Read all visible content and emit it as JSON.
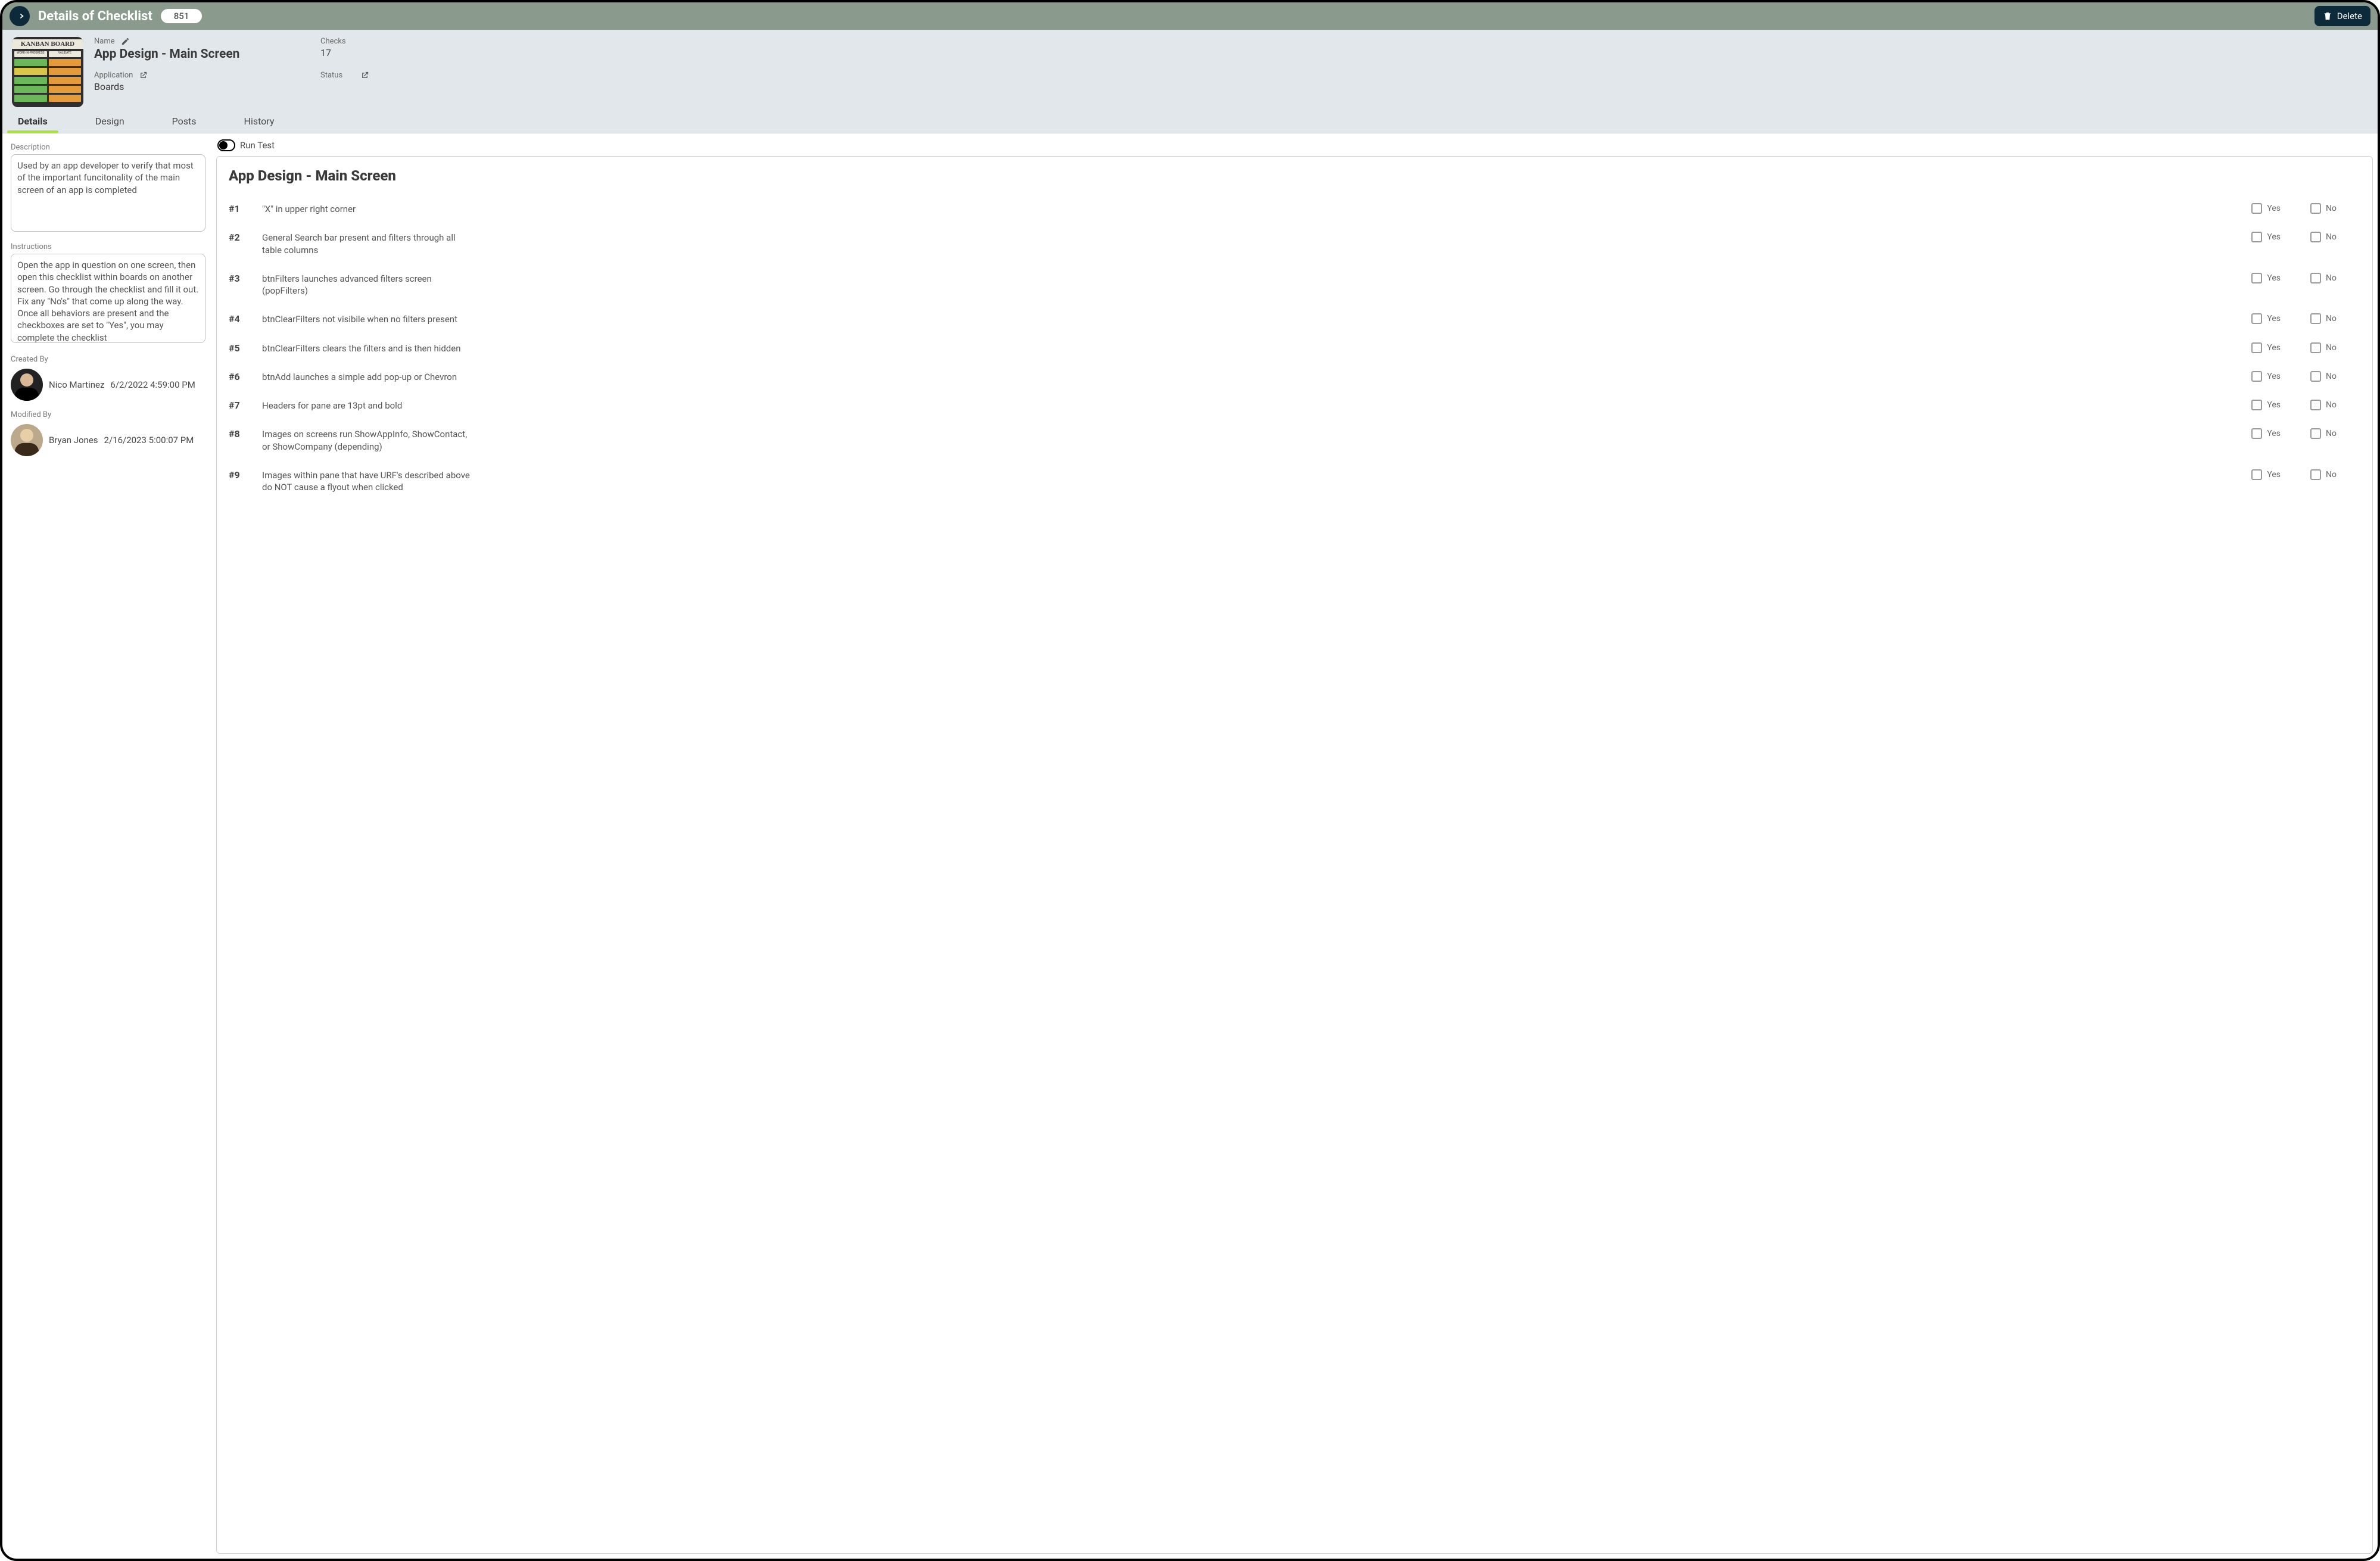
{
  "header": {
    "title": "Details of Checklist",
    "badge": "851",
    "delete_label": "Delete"
  },
  "thumbnail": {
    "title": "KANBAN BOARD",
    "col_labels": [
      "WORK-IN-PROGRESS",
      "VALIDATE"
    ]
  },
  "info": {
    "name_label": "Name",
    "name_value": "App Design - Main Screen",
    "application_label": "Application",
    "application_value": "Boards",
    "checks_label": "Checks",
    "checks_value": "17",
    "status_label": "Status",
    "status_value": ""
  },
  "tabs": [
    {
      "key": "details",
      "label": "Details",
      "active": true
    },
    {
      "key": "design",
      "label": "Design",
      "active": false
    },
    {
      "key": "posts",
      "label": "Posts",
      "active": false
    },
    {
      "key": "history",
      "label": "History",
      "active": false
    }
  ],
  "left": {
    "description_label": "Description",
    "description_value": "Used by an app developer to verify that most of the important funcitonality of the main screen of an app is completed",
    "instructions_label": "Instructions",
    "instructions_value": "Open the app in question on one screen, then open this checklist within boards on another screen. Go through the checklist and fill it out. Fix any \"No's\" that come up along the way. Once all behaviors are present and the checkboxes are set to \"Yes\", you may complete the checklist",
    "created_label": "Created By",
    "created_name": "Nico Martinez",
    "created_date": "6/2/2022 4:59:00 PM",
    "modified_label": "Modified By",
    "modified_name": "Bryan Jones",
    "modified_date": "2/16/2023 5:00:07 PM"
  },
  "runtest_label": "Run Test",
  "checklist": {
    "title": "App Design - Main Screen",
    "yes_label": "Yes",
    "no_label": "No",
    "items": [
      {
        "num": "#1",
        "text": "\"X\" in upper right corner"
      },
      {
        "num": "#2",
        "text": "General Search bar present and filters through all table columns"
      },
      {
        "num": "#3",
        "text": "btnFilters launches advanced filters screen (popFilters)"
      },
      {
        "num": "#4",
        "text": "btnClearFilters not visibile when no filters present"
      },
      {
        "num": "#5",
        "text": "btnClearFilters clears the filters and is then hidden"
      },
      {
        "num": "#6",
        "text": "btnAdd launches a simple add pop-up or Chevron"
      },
      {
        "num": "#7",
        "text": "Headers for pane are 13pt and bold"
      },
      {
        "num": "#8",
        "text": "Images on screens run ShowAppInfo, ShowContact, or ShowCompany (depending)"
      },
      {
        "num": "#9",
        "text": "Images within pane that have URF's described above do NOT cause a flyout when clicked"
      }
    ]
  }
}
